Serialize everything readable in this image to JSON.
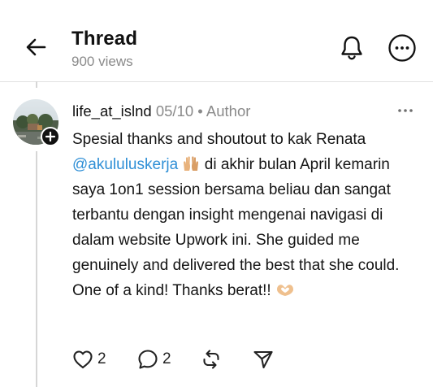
{
  "header": {
    "title": "Thread",
    "views": "900 views"
  },
  "post": {
    "username": "life_at_islnd",
    "date": "05/10",
    "separator": "•",
    "role": "Author",
    "body_segments": [
      "Spesial thanks and shoutout to kak Renata ",
      "@akululuskerja",
      " di akhir bulan April kemarin saya 1on1 session bersama beliau dan sangat terbantu dengan insight mengenai navigasi di dalam website Upwork ini. She guided me genuinely and delivered the best that she could. One of a kind! Thanks berat!! "
    ],
    "emojis": [
      "raised-hands-emoji",
      "heart-hands-emoji"
    ],
    "likes": "2",
    "replies": "2"
  },
  "icons": {
    "back": "back-arrow-icon",
    "notifications": "bell-icon",
    "more": "more-icon",
    "like": "heart-icon",
    "reply": "comment-icon",
    "repost": "repost-icon",
    "share": "send-icon"
  },
  "colors": {
    "mention": "#2f8fd6",
    "muted": "#8a8a8a",
    "text": "#111111"
  }
}
